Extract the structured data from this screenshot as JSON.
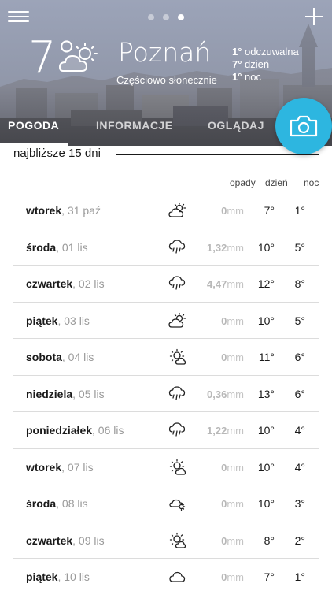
{
  "header": {
    "current_temp": "7°",
    "weather_icon": "partly-sunny-icon",
    "city": "Poznań",
    "condition": "Częściowo słonecznie",
    "details": [
      {
        "value": "1°",
        "label": " odczuwalna"
      },
      {
        "value": "7°",
        "label": " dzień"
      },
      {
        "value": "1°",
        "label": " noc"
      }
    ],
    "page_dots": {
      "count": 3,
      "active_index": 2
    }
  },
  "tabs": [
    {
      "label": "POGODA",
      "active": true
    },
    {
      "label": "INFORMACJE",
      "active": false
    },
    {
      "label": "OGLĄDAJ",
      "active": false
    }
  ],
  "forecast": {
    "title": "najbliższe 15 dni",
    "columns": {
      "rain": "opady",
      "day": "dzień",
      "night": "noc"
    },
    "rain_unit": "mm",
    "days": [
      {
        "day": "wtorek",
        "date": ", 31 paź",
        "icon": "partly-cloudy-icon",
        "rain": "0",
        "t_day": "7°",
        "t_night": "1°"
      },
      {
        "day": "środa",
        "date": ", 01 lis",
        "icon": "rain-icon",
        "rain": "1,32",
        "t_day": "10°",
        "t_night": "5°"
      },
      {
        "day": "czwartek",
        "date": ", 02 lis",
        "icon": "rain-icon",
        "rain": "4,47",
        "t_day": "12°",
        "t_night": "8°"
      },
      {
        "day": "piątek",
        "date": ", 03 lis",
        "icon": "partly-cloudy-icon",
        "rain": "0",
        "t_day": "10°",
        "t_night": "5°"
      },
      {
        "day": "sobota",
        "date": ", 04 lis",
        "icon": "sun-cloud-icon",
        "rain": "0",
        "t_day": "11°",
        "t_night": "6°"
      },
      {
        "day": "niedziela",
        "date": ", 05 lis",
        "icon": "rain-icon",
        "rain": "0,36",
        "t_day": "13°",
        "t_night": "6°"
      },
      {
        "day": "poniedziałek",
        "date": ", 06 lis",
        "icon": "rain-icon",
        "rain": "1,22",
        "t_day": "10°",
        "t_night": "4°"
      },
      {
        "day": "wtorek",
        "date": ", 07 lis",
        "icon": "sun-cloud-icon",
        "rain": "0",
        "t_day": "10°",
        "t_night": "4°"
      },
      {
        "day": "środa",
        "date": ", 08 lis",
        "icon": "cloud-sun-small-icon",
        "rain": "0",
        "t_day": "10°",
        "t_night": "3°"
      },
      {
        "day": "czwartek",
        "date": ", 09 lis",
        "icon": "sun-cloud-icon",
        "rain": "0",
        "t_day": "8°",
        "t_night": "2°"
      },
      {
        "day": "piątek",
        "date": ", 10 lis",
        "icon": "cloud-icon",
        "rain": "0",
        "t_day": "7°",
        "t_night": "1°"
      }
    ]
  },
  "colors": {
    "accent": "#2db6e0",
    "text": "#1a1a1a",
    "muted": "#9a9a9a",
    "rain": "#b8b8b8"
  }
}
